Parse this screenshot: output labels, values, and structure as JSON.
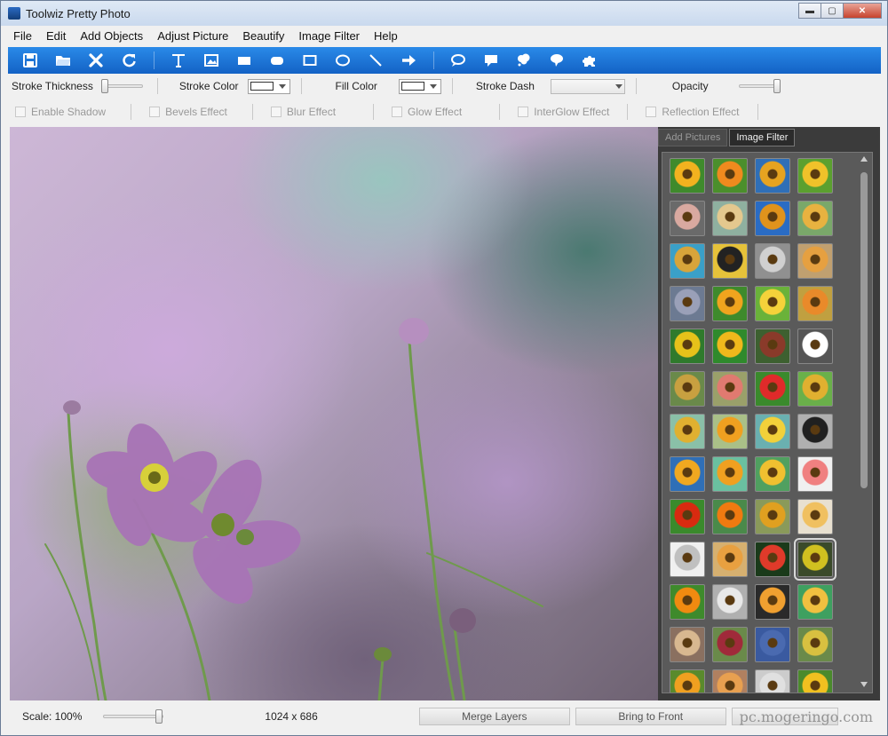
{
  "window": {
    "title": "Toolwiz Pretty Photo",
    "minimize": "▬",
    "maximize": "▢",
    "close": "✕"
  },
  "menu": [
    "File",
    "Edit",
    "Add Objects",
    "Adjust Picture",
    "Beautify",
    "Image Filter",
    "Help"
  ],
  "toolbar": {
    "accent": "#1a74d8",
    "tools": [
      "save-icon",
      "open-folder-icon",
      "delete-icon",
      "refresh-icon",
      "text-icon",
      "image-icon",
      "filled-rectangle-icon",
      "rounded-rectangle-icon",
      "rectangle-icon",
      "ellipse-icon",
      "line-icon",
      "arrow-icon",
      "speech-bubble-icon",
      "callout-rect-icon",
      "thought-bubble-icon",
      "cloud-callout-icon",
      "puzzle-icon"
    ]
  },
  "props": {
    "stroke_thickness": "Stroke Thickness",
    "stroke_color": "Stroke Color",
    "fill_color": "Fill Color",
    "stroke_dash": "Stroke Dash",
    "opacity": "Opacity",
    "stroke_thickness_level": 0.0,
    "opacity_level": 1.0
  },
  "effects": {
    "shadow": "Enable Shadow",
    "bevels": "Bevels Effect",
    "blur": "Blur Effect",
    "glow": "Glow Effect",
    "interglow": "InterGlow Effect",
    "reflection": "Reflection Effect"
  },
  "panel": {
    "tabs": [
      "Add Pictures",
      "Image Filter"
    ],
    "active_tab": "Image Filter",
    "selected_thumb": 39,
    "thumb_count": 52
  },
  "status": {
    "scale": "Scale: 100%",
    "scale_level": 1.0,
    "dimensions": "1024 x 686",
    "merge": "Merge Layers",
    "front": "Bring to Front",
    "watermark": "pc.mogeringo.com"
  }
}
